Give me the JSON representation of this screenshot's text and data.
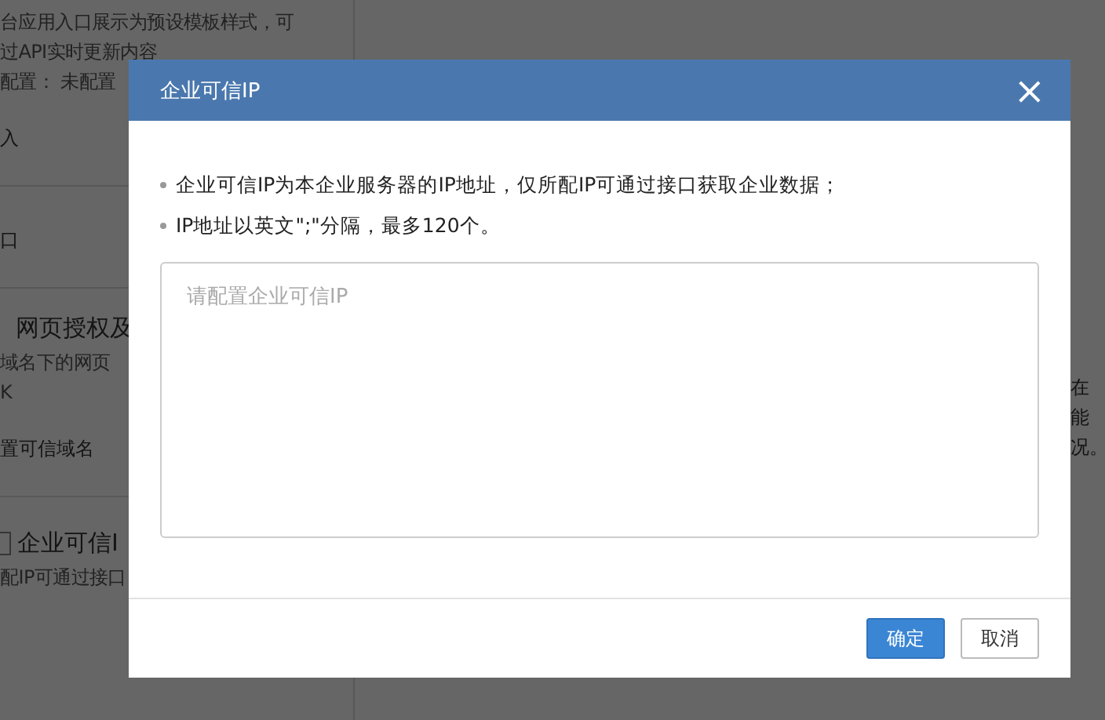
{
  "background": {
    "left_lines": [
      {
        "kind": "desc",
        "text": "台应用入口展示为预设模板样式，可"
      },
      {
        "kind": "desc",
        "text": "过API实时更新内容"
      },
      {
        "kind": "desc",
        "text": "配置： 未配置"
      },
      {
        "kind": "link",
        "text": "入"
      },
      {
        "kind": "divider"
      },
      {
        "kind": "link",
        "text": "口"
      },
      {
        "kind": "divider"
      },
      {
        "kind": "heading",
        "text": "网页授权及"
      },
      {
        "kind": "desc",
        "text": "域名下的网页"
      },
      {
        "kind": "desc",
        "text": "K"
      },
      {
        "kind": "link",
        "text": "置可信域名"
      },
      {
        "kind": "divider"
      },
      {
        "kind": "check_heading",
        "text": "企业可信I",
        "checked": false
      },
      {
        "kind": "desc",
        "text": "配IP可通过接口"
      }
    ],
    "right_lines": [
      "在",
      "能",
      "况。"
    ]
  },
  "dialog": {
    "title": "企业可信IP",
    "close": "×",
    "notes": [
      "企业可信IP为本企业服务器的IP地址，仅所配IP可通过接口获取企业数据；",
      "IP地址以英文\";\"分隔，最多120个。"
    ],
    "input": {
      "placeholder": "请配置企业可信IP"
    },
    "buttons": [
      {
        "label": "确定",
        "kind": "primary"
      },
      {
        "label": "取消",
        "kind": "secondary"
      }
    ]
  }
}
